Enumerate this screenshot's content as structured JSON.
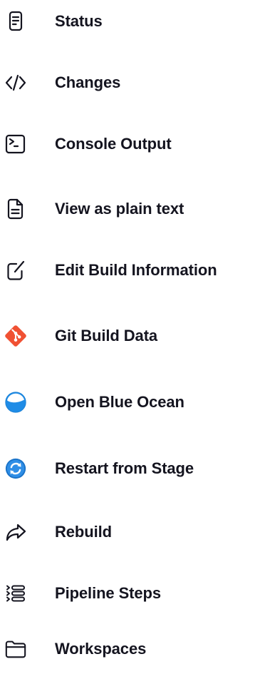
{
  "tasks": [
    {
      "label": "Status",
      "icon": "document-lines-icon"
    },
    {
      "label": "Changes",
      "icon": "code-icon"
    },
    {
      "label": "Console Output",
      "icon": "terminal-icon"
    },
    {
      "label": "View as plain text",
      "icon": "file-text-icon"
    },
    {
      "label": "Edit Build Information",
      "icon": "edit-icon"
    },
    {
      "label": "Git Build Data",
      "icon": "git-logo-icon"
    },
    {
      "label": "Open Blue Ocean",
      "icon": "blue-ocean-icon"
    },
    {
      "label": "Restart from Stage",
      "icon": "restart-icon"
    },
    {
      "label": "Rebuild",
      "icon": "rebuild-arrow-icon"
    },
    {
      "label": "Pipeline Steps",
      "icon": "pipeline-steps-icon"
    },
    {
      "label": "Workspaces",
      "icon": "folder-icon"
    }
  ],
  "colors": {
    "text": "#14141f",
    "git_orange": "#f05133",
    "ocean_blue": "#1f8ce6",
    "restart_blue": "#1a73c8"
  }
}
